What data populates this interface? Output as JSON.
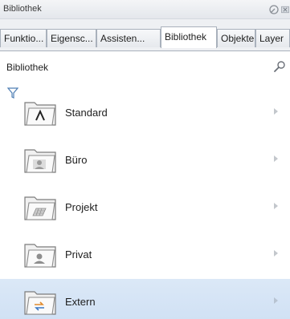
{
  "window": {
    "title": "Bibliothek",
    "pin_icon": "pin-icon",
    "close_icon": "close-icon"
  },
  "tabs": [
    {
      "label": "Funktio...",
      "active": false
    },
    {
      "label": "Eigensc...",
      "active": false
    },
    {
      "label": "Assisten...",
      "active": false
    },
    {
      "label": "Bibliothek",
      "active": true
    },
    {
      "label": "Objekte",
      "active": false
    },
    {
      "label": "Layer",
      "active": false
    }
  ],
  "header": {
    "title": "Bibliothek",
    "search_icon": "search-icon",
    "filter_icon": "filter-icon"
  },
  "library_items": [
    {
      "label": "Standard",
      "icon": "standard-folder-icon",
      "selected": false
    },
    {
      "label": "Büro",
      "icon": "office-folder-icon",
      "selected": false
    },
    {
      "label": "Projekt",
      "icon": "project-folder-icon",
      "selected": false
    },
    {
      "label": "Privat",
      "icon": "private-folder-icon",
      "selected": false
    },
    {
      "label": "Extern",
      "icon": "external-folder-icon",
      "selected": true
    }
  ],
  "colors": {
    "selection": "#d4e4f6",
    "tab_border": "#a9b1bc",
    "title_bar": "#e8ebef"
  }
}
